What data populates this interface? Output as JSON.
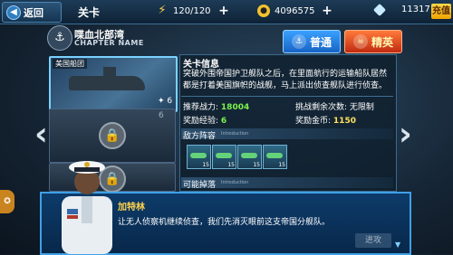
{
  "header": {
    "back_label": "返回",
    "title": "关卡",
    "energy": "120/120",
    "gold": "4096575",
    "diamonds": "11317",
    "recharge_label": "充值"
  },
  "chapter": {
    "title": "喋血北部湾",
    "subtitle": "CHAPTER NAME"
  },
  "stages": [
    {
      "label": "美国船团",
      "stars": "6",
      "locked": false
    },
    {
      "label": "",
      "stars": "6",
      "locked": true
    },
    {
      "label": "",
      "stars": "",
      "locked": true
    }
  ],
  "difficulty": {
    "normal": "普通",
    "elite": "精英"
  },
  "info": {
    "title": "关卡信息",
    "description": "突破外围帝国护卫舰队之后，在里面航行的运输船队居然都是打着美国旗帜的战舰，马上派出侦查舰队进行侦查。",
    "power_label": "推荐战力:",
    "power_value": "18004",
    "challenges_label": "挑战剩余次数:",
    "challenges_value": "无限制",
    "exp_label": "奖励经验:",
    "exp_value": "6",
    "gold_label": "奖励金币:",
    "gold_value": "1150",
    "enemy_title": "敌方阵容",
    "enemy_sub": "Introduction",
    "enemy_counts": [
      "15",
      "15",
      "15",
      "15"
    ],
    "drops_title": "可能掉落",
    "drops_sub": "Introduction"
  },
  "dialogue": {
    "speaker": "加特林",
    "text": "让无人侦察机继续侦查，我们先消灭眼前这支帝国分舰队。",
    "continue_label": "进攻"
  },
  "colors": {
    "accent_blue": "#3fa0e6",
    "highlight_green": "#79f24d",
    "gold_text": "#ffe15a",
    "speaker_yellow": "#ffd24d"
  }
}
